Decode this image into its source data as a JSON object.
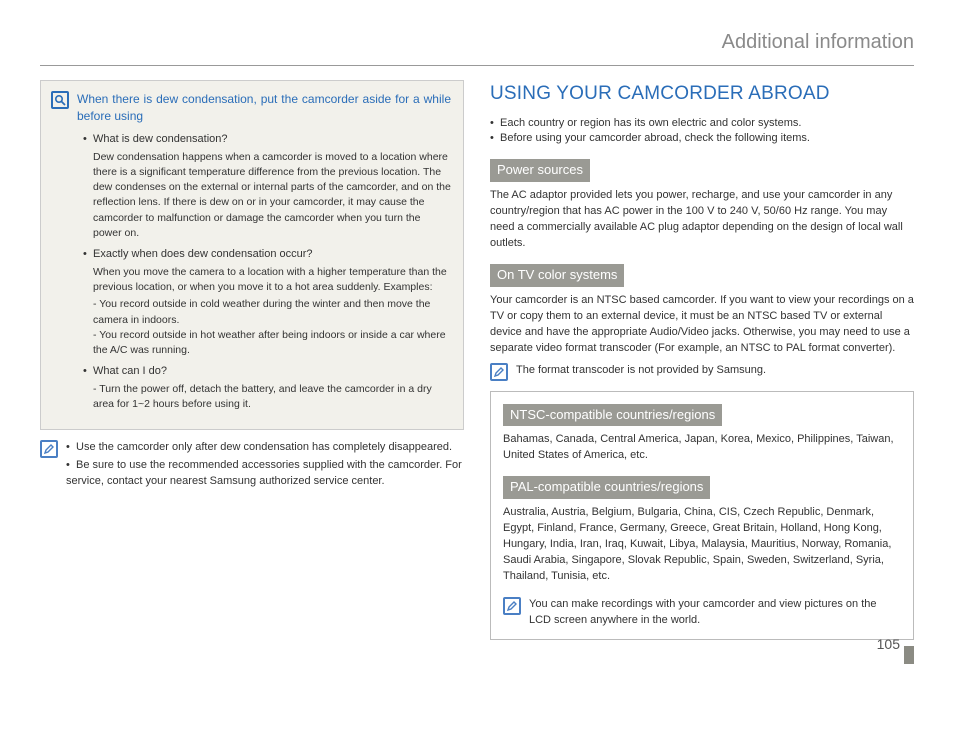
{
  "header": {
    "title": "Additional information"
  },
  "left": {
    "callout": {
      "title": "When there is dew condensation, put the camcorder aside for a while before using",
      "q1": "What is dew condensation?",
      "a1": "Dew condensation happens when a camcorder is moved to a location where there is a significant temperature difference from the previous location. The dew condenses on the external or internal parts of the camcorder, and on the reflection lens. If there is dew on or in your camcorder, it may cause the camcorder to malfunction or damage the camcorder when you turn the power on.",
      "q2": "Exactly when does dew condensation occur?",
      "a2": "When you move the camera to a location with a higher temperature than the previous location, or when you move it to a hot area suddenly. Examples:",
      "a2_sub1": "You record outside in cold weather during the winter and then move the camera in indoors.",
      "a2_sub2": "You record outside in hot weather after being indoors or inside a car where the A/C was running.",
      "q3": "What can I do?",
      "a3_sub1": "Turn the power off, detach the battery, and leave the camcorder in a dry area for 1~2 hours before using it."
    },
    "notes": {
      "n1": "Use the camcorder only after dew condensation has completely disappeared.",
      "n2": "Be sure to use the recommended accessories supplied with the camcorder. For service, contact your nearest Samsung authorized service center."
    }
  },
  "right": {
    "title": "USING YOUR CAMCORDER ABROAD",
    "intro1": "Each country or region has its own electric and color systems.",
    "intro2": "Before using your camcorder abroad, check the following items.",
    "power_head": "Power sources",
    "power_body": "The AC adaptor provided lets you power, recharge, and use your camcorder in any country/region that has AC power in the 100 V to 240 V, 50/60 Hz range. You may need a commercially available AC plug adaptor depending on the design of local wall outlets.",
    "tv_head": "On TV color systems",
    "tv_body": "Your camcorder is an NTSC based camcorder. If you want to view your recordings on a TV or copy them to an external device, it must be an NTSC based TV or external device and have the appropriate Audio/Video jacks. Otherwise, you may need to use a separate video format transcoder (For example, an NTSC to PAL format converter).",
    "tv_note": "The format transcoder is not provided by Samsung.",
    "ntsc_head": "NTSC-compatible countries/regions",
    "ntsc_body": "Bahamas, Canada, Central America, Japan, Korea, Mexico, Philippines, Taiwan, United States of America, etc.",
    "pal_head": "PAL-compatible countries/regions",
    "pal_body": "Australia, Austria, Belgium, Bulgaria, China, CIS, Czech Republic, Denmark, Egypt, Finland, France, Germany, Greece, Great Britain, Holland, Hong Kong, Hungary, India, Iran, Iraq, Kuwait, Libya, Malaysia, Mauritius, Norway, Romania, Saudi Arabia, Singapore, Slovak Republic, Spain, Sweden, Switzerland, Syria, Thailand, Tunisia, etc.",
    "region_note": "You can make recordings with your camcorder and view pictures on the LCD screen anywhere in the world."
  },
  "page": "105"
}
